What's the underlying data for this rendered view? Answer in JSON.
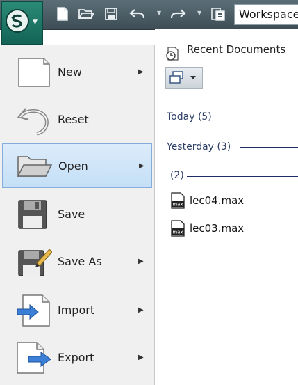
{
  "toolbar": {
    "icons": [
      "new-file-icon",
      "open-folder-icon",
      "save-icon",
      "undo-icon",
      "redo-icon",
      "project-folder-icon"
    ],
    "workspace_label": "Workspace"
  },
  "menu": {
    "items": [
      {
        "label": "New",
        "icon": "new-document-icon",
        "has_submenu": true
      },
      {
        "label": "Reset",
        "icon": "reset-icon",
        "has_submenu": false
      },
      {
        "label": "Open",
        "icon": "open-folder-icon",
        "has_submenu": true
      },
      {
        "label": "Save",
        "icon": "floppy-disk-icon",
        "has_submenu": false
      },
      {
        "label": "Save As",
        "icon": "save-as-icon",
        "has_submenu": true
      },
      {
        "label": "Import",
        "icon": "import-icon",
        "has_submenu": true
      },
      {
        "label": "Export",
        "icon": "export-icon",
        "has_submenu": true
      }
    ]
  },
  "recent": {
    "title": "Recent Documents",
    "groups": [
      {
        "label": "Today (5)"
      },
      {
        "label": "Yesterday (3)"
      },
      {
        "label": "(2)"
      }
    ],
    "files": [
      {
        "name": "lec04.max",
        "icon_text": "max"
      },
      {
        "name": "lec03.max",
        "icon_text": "max"
      }
    ]
  },
  "colors": {
    "toolbar": "#4b5c64",
    "app_button": "#1d7a66",
    "menu_bg": "#f0f0f0",
    "active_item": "#c4dff6",
    "group_line": "#1f2d66"
  }
}
